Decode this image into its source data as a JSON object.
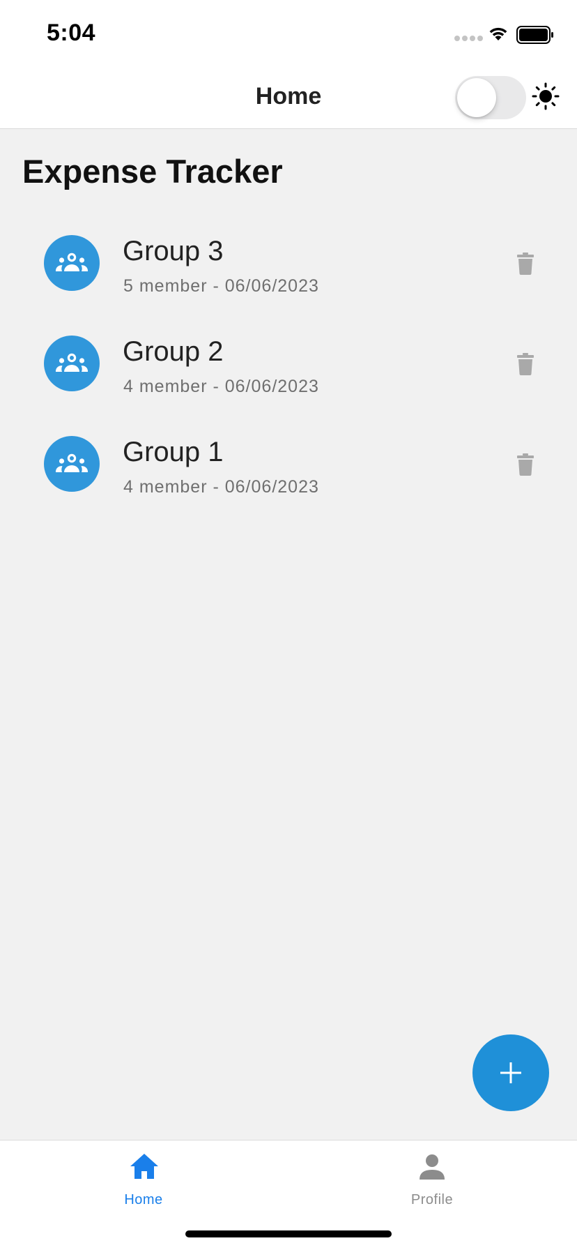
{
  "status_bar": {
    "time": "5:04"
  },
  "header": {
    "title": "Home",
    "theme_toggle_on": false
  },
  "main": {
    "title": "Expense Tracker",
    "groups": [
      {
        "name": "Group 3",
        "meta": "5 member - 06/06/2023"
      },
      {
        "name": "Group 2",
        "meta": "4 member - 06/06/2023"
      },
      {
        "name": "Group 1",
        "meta": "4 member - 06/06/2023"
      }
    ]
  },
  "fab": {
    "icon": "plus-icon"
  },
  "tabs": [
    {
      "label": "Home",
      "icon": "home-icon",
      "active": true
    },
    {
      "label": "Profile",
      "icon": "person-icon",
      "active": false
    }
  ],
  "colors": {
    "accent": "#3097db",
    "fab": "#1f90d8",
    "active_tab": "#1a7fea",
    "inactive_tab": "#8c8c8c",
    "background": "#f1f1f1"
  }
}
